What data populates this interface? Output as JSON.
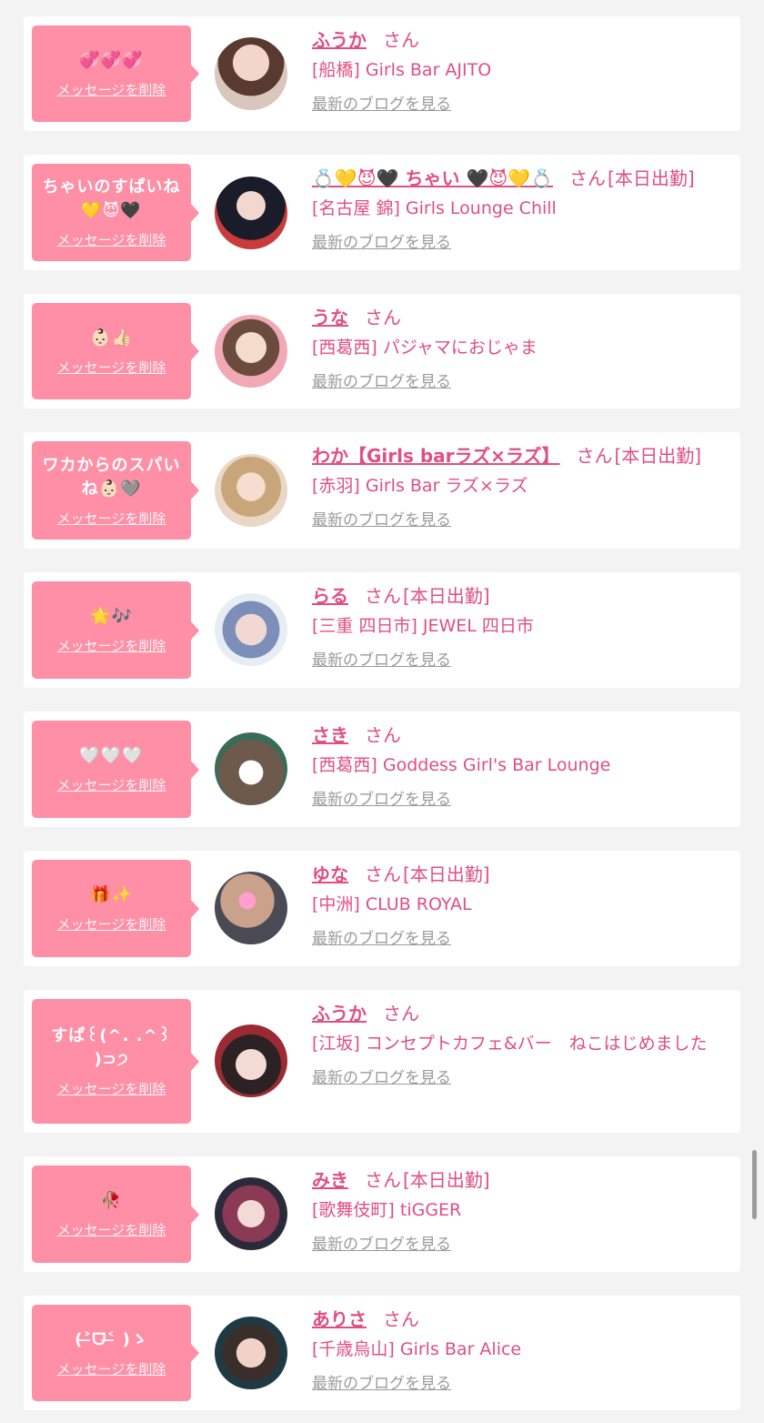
{
  "colors": {
    "page_bg": "#f3f3f3",
    "card_bg": "#ffffff",
    "bubble_bg": "#fe8fa6",
    "accent_pink": "#e04f7f",
    "link_gray": "#9a9a9a"
  },
  "items": [
    {
      "bubble_text": "💞💞💞",
      "delete_label": "メッセージを削除",
      "name": "ふうか",
      "suffix": "さん",
      "status": "",
      "shop": "[船橋] Girls Bar AJITO",
      "blog_label": "最新のブログを見る"
    },
    {
      "bubble_text": "ちゃいのすぱいね💛😈🖤",
      "delete_label": "メッセージを削除",
      "name": "💍💛😈🖤 ちゃい 🖤😈💛💍",
      "suffix": "さん",
      "status": "[本日出勤]",
      "shop": "[名古屋 錦] Girls Lounge Chill",
      "blog_label": "最新のブログを見る"
    },
    {
      "bubble_text": "👶🏻👍🏻",
      "delete_label": "メッセージを削除",
      "name": "うな",
      "suffix": "さん",
      "status": "",
      "shop": "[西葛西] パジャマにおじゃま",
      "blog_label": "最新のブログを見る"
    },
    {
      "bubble_text": "ワカからのスパいね👶🏻🩶",
      "delete_label": "メッセージを削除",
      "name": "わか【Girls barラズ×ラズ】",
      "suffix": "さん",
      "status": "[本日出勤]",
      "shop": "[赤羽] Girls Bar ラズ×ラズ",
      "blog_label": "最新のブログを見る"
    },
    {
      "bubble_text": "🌟🎶",
      "delete_label": "メッセージを削除",
      "name": "らる",
      "suffix": "さん",
      "status": "[本日出勤]",
      "shop": "[三重 四日市] JEWEL 四日市",
      "blog_label": "最新のブログを見る"
    },
    {
      "bubble_text": "🤍🤍🤍",
      "delete_label": "メッセージを削除",
      "name": "さき",
      "suffix": "さん",
      "status": "",
      "shop": "[西葛西] Goddess Girl's Bar Lounge",
      "blog_label": "最新のブログを見る"
    },
    {
      "bubble_text": "🎁✨",
      "delete_label": "メッセージを削除",
      "name": "ゆな",
      "suffix": "さん",
      "status": "[本日出勤]",
      "shop": "[中洲] CLUB ROYAL",
      "blog_label": "最新のブログを見る"
    },
    {
      "bubble_text": "すぱ꒰(^. .^꒱ )⊃੭",
      "delete_label": "メッセージを削除",
      "name": "ふうか",
      "suffix": "さん",
      "status": "",
      "shop": "[江坂] コンセプトカフェ&バー　ねこはじめました",
      "blog_label": "最新のブログを見る"
    },
    {
      "bubble_text": "🥀",
      "delete_label": "メッセージを削除",
      "name": "みき",
      "suffix": "さん",
      "status": "[本日出勤]",
      "shop": "[歌舞伎町] tiGGER",
      "blog_label": "最新のブログを見る"
    },
    {
      "bubble_text": "(˃̶ᗜ˂̶ )ゝ",
      "delete_label": "メッセージを削除",
      "name": "ありさ",
      "suffix": "さん",
      "status": "",
      "shop": "[千歳烏山] Girls Bar Alice",
      "blog_label": "最新のブログを見る"
    }
  ]
}
